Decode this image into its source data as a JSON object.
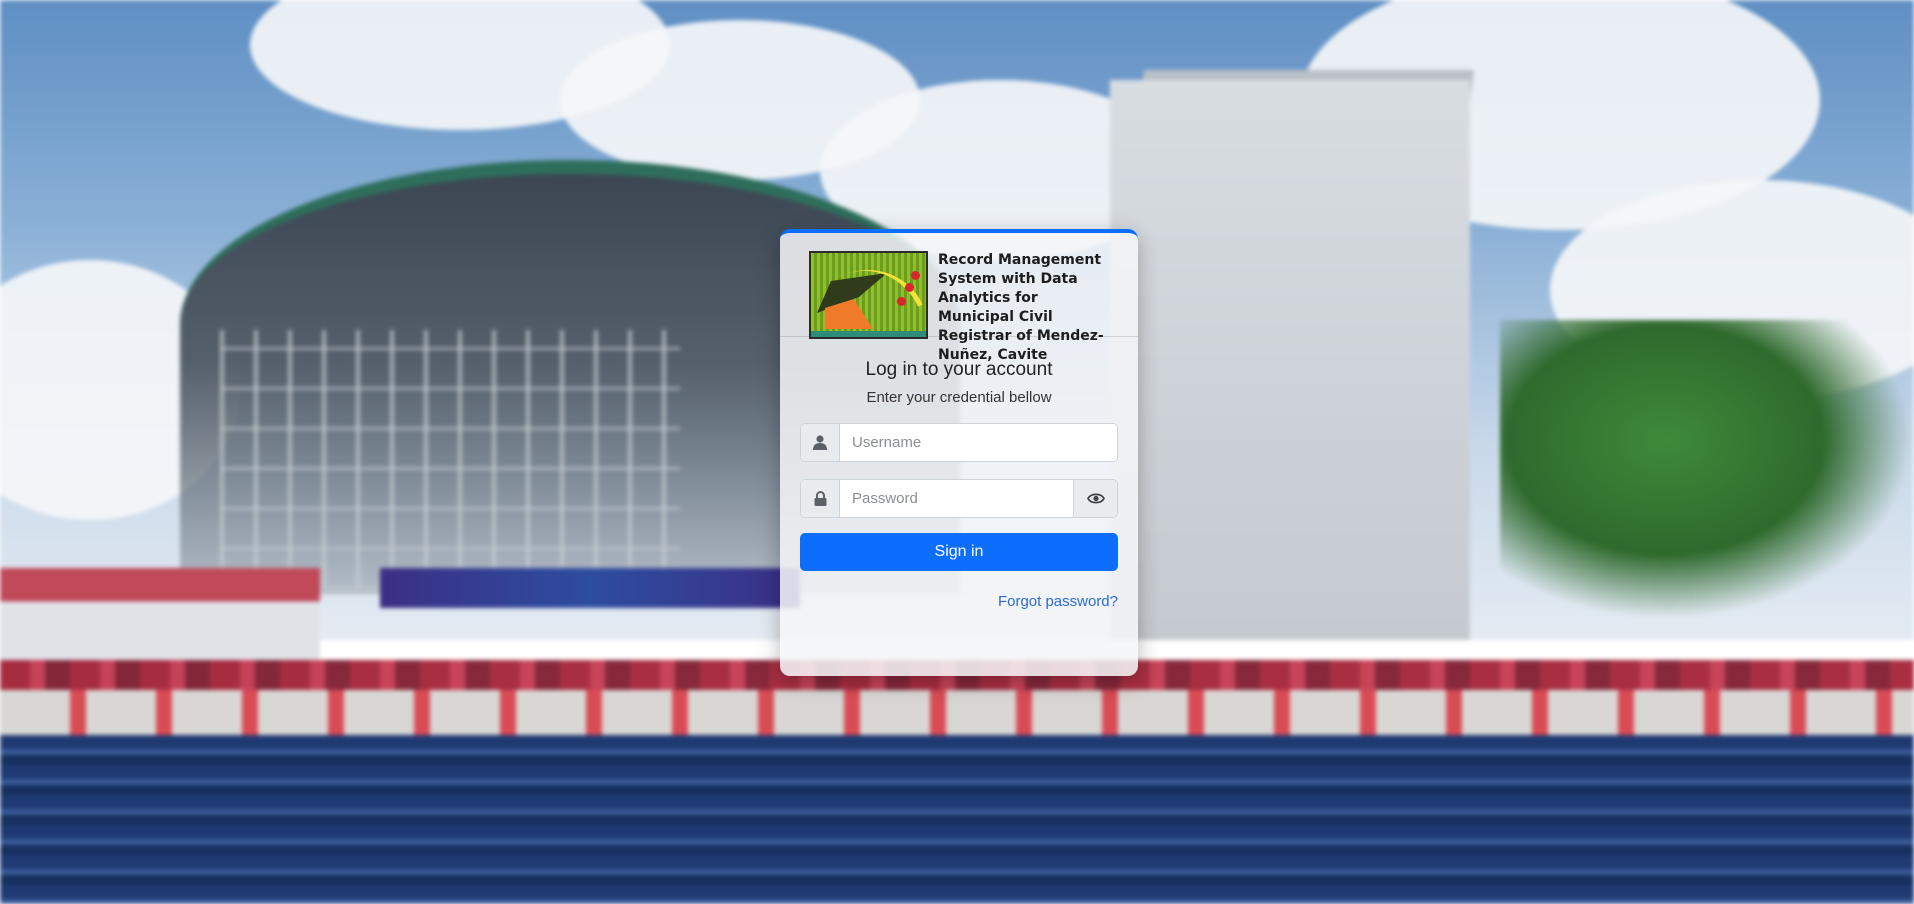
{
  "app": {
    "title": "Record Management System with Data Analytics for Municipal Civil Registrar of Mendez-Nuñez, Cavite"
  },
  "login": {
    "heading": "Log in to your account",
    "subheading": "Enter your credential bellow",
    "username_placeholder": "Username",
    "password_placeholder": "Password",
    "sign_in_label": "Sign in",
    "forgot_password_label": "Forgot password?"
  },
  "icons": {
    "username": "user-icon",
    "password": "lock-icon",
    "toggle_password": "eye-icon"
  },
  "colors": {
    "accent": "#0d6efd",
    "link": "#2b6cd1"
  }
}
